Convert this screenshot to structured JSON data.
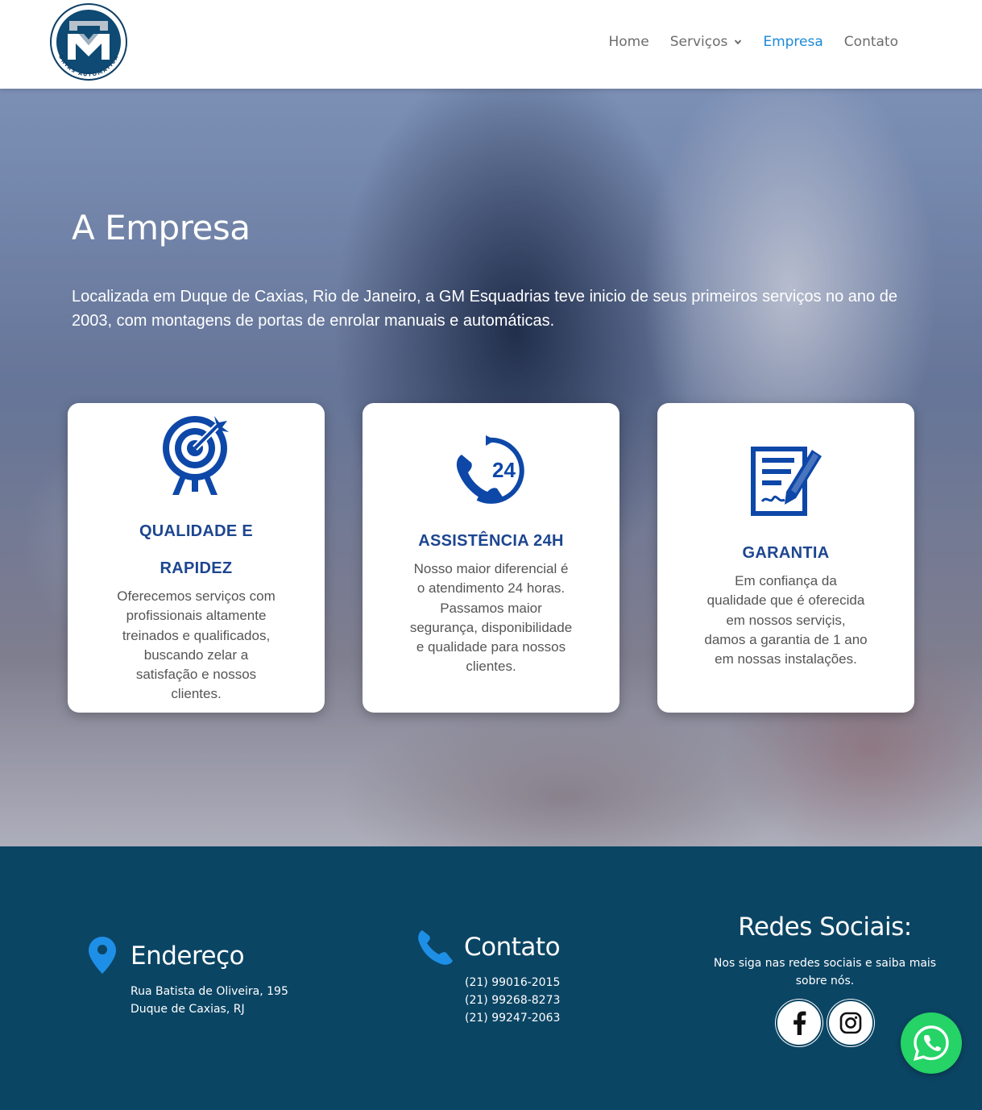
{
  "header": {
    "logo_caption": "PORTAS AUTOMÁTICAS",
    "nav": [
      {
        "label": "Home"
      },
      {
        "label": "Serviços"
      },
      {
        "label": "Empresa"
      },
      {
        "label": "Contato"
      }
    ],
    "active": "Empresa"
  },
  "hero": {
    "title": "A Empresa",
    "text": "Localizada em Duque de Caxias, Rio de Janeiro, a GM Esquadrias teve inicio de seus primeiros serviços no ano de 2003, com montagens de portas de enrolar manuais e automáticas."
  },
  "cards": [
    {
      "icon": "target-icon",
      "title_line1": "QUALIDADE E",
      "title_line2": "RAPIDEZ",
      "lines": [
        "Oferecemos serviços com",
        "profissionais altamente",
        "treinados e qualificados,",
        "buscando zelar a",
        "satisfação e nossos",
        "clientes."
      ]
    },
    {
      "icon": "phone-24h-icon",
      "title": "ASSISTÊNCIA 24H",
      "lines": [
        "Nosso maior diferencial é",
        "o atendimento 24 horas.",
        "Passamos maior",
        "segurança, disponibilidade",
        "e qualidade para nossos",
        "clientes."
      ]
    },
    {
      "icon": "contract-icon",
      "title": "GARANTIA",
      "lines": [
        "Em confiança da",
        "qualidade que é oferecida",
        "em nossos serviçis,",
        "damos a garantia de 1 ano",
        "em nossas instalações."
      ]
    }
  ],
  "footer": {
    "address": {
      "heading": "Endereço",
      "lines": [
        "Rua Batista de Oliveira, 195",
        "Duque de Caxias, RJ"
      ]
    },
    "contact": {
      "heading": "Contato",
      "phones": [
        "(21) 99016-2015",
        "(21) 99268-8273",
        "(21) 99247-2063"
      ]
    },
    "social": {
      "heading": "Redes Sociais:",
      "lines": [
        "Nos siga nas redes sociais e saiba mais",
        "sobre nós."
      ],
      "links": [
        "facebook-icon",
        "instagram-icon"
      ]
    }
  },
  "colors": {
    "accent": "#1a8ad8",
    "card_title": "#1d4690",
    "icon_blue": "#0d47a8",
    "footer_bg": "#0b4564",
    "whatsapp": "#25d366"
  }
}
